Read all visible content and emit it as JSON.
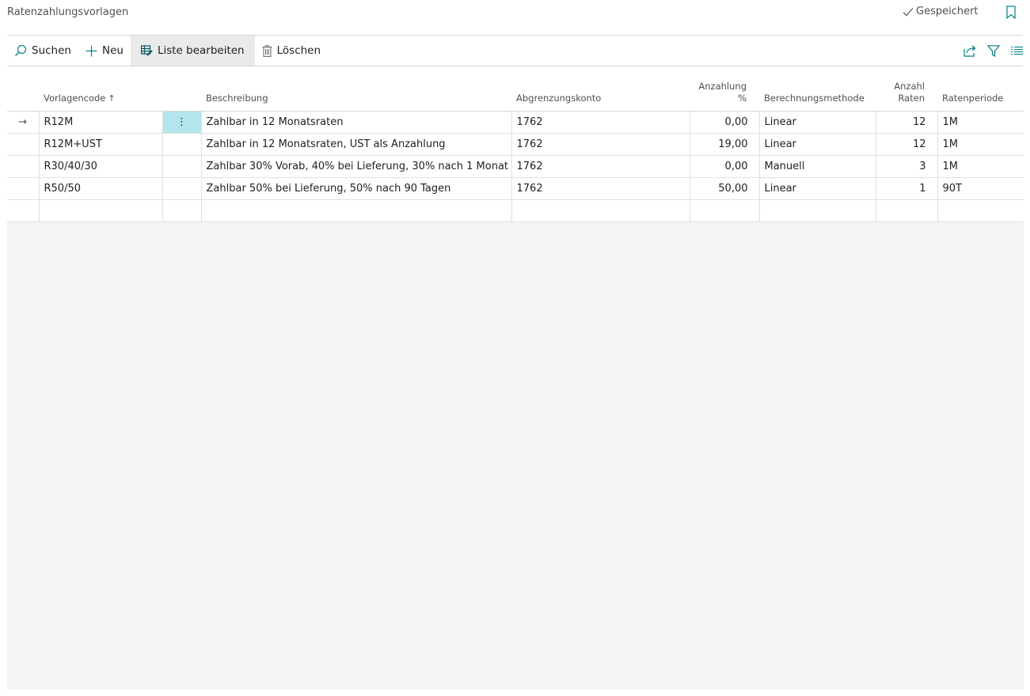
{
  "page": {
    "title": "Ratenzahlungsvorlagen",
    "saved_status": "Gespeichert"
  },
  "toolbar": {
    "search_label": "Suchen",
    "new_label": "Neu",
    "edit_list_label": "Liste bearbeiten",
    "delete_label": "Löschen"
  },
  "columns": {
    "code": "Vorlagencode",
    "description": "Beschreibung",
    "account": "Abgrenzungskonto",
    "down_payment_1": "Anzahlung",
    "down_payment_2": "%",
    "method": "Berechnungsmethode",
    "count_1": "Anzahl",
    "count_2": "Raten",
    "period": "Ratenperiode"
  },
  "rows": [
    {
      "code": "R12M",
      "description": "Zahlbar in 12 Monatsraten",
      "account": "1762",
      "down_payment": "0,00",
      "method": "Linear",
      "count": "12",
      "period": "1M"
    },
    {
      "code": "R12M+UST",
      "description": "Zahlbar in 12 Monatsraten, UST als Anzahlung",
      "account": "1762",
      "down_payment": "19,00",
      "method": "Linear",
      "count": "12",
      "period": "1M"
    },
    {
      "code": "R30/40/30",
      "description": "Zahlbar 30% Vorab, 40% bei Lieferung, 30% nach 1 Monat",
      "account": "1762",
      "down_payment": "0,00",
      "method": "Manuell",
      "count": "3",
      "period": "1M"
    },
    {
      "code": "R50/50",
      "description": "Zahlbar 50% bei Lieferung, 50% nach 90 Tagen",
      "account": "1762",
      "down_payment": "50,00",
      "method": "Linear",
      "count": "1",
      "period": "90T"
    }
  ],
  "colors": {
    "accent": "#008489",
    "selected_cell": "#b3e6ec",
    "empty_area": "#f4f5f6"
  }
}
